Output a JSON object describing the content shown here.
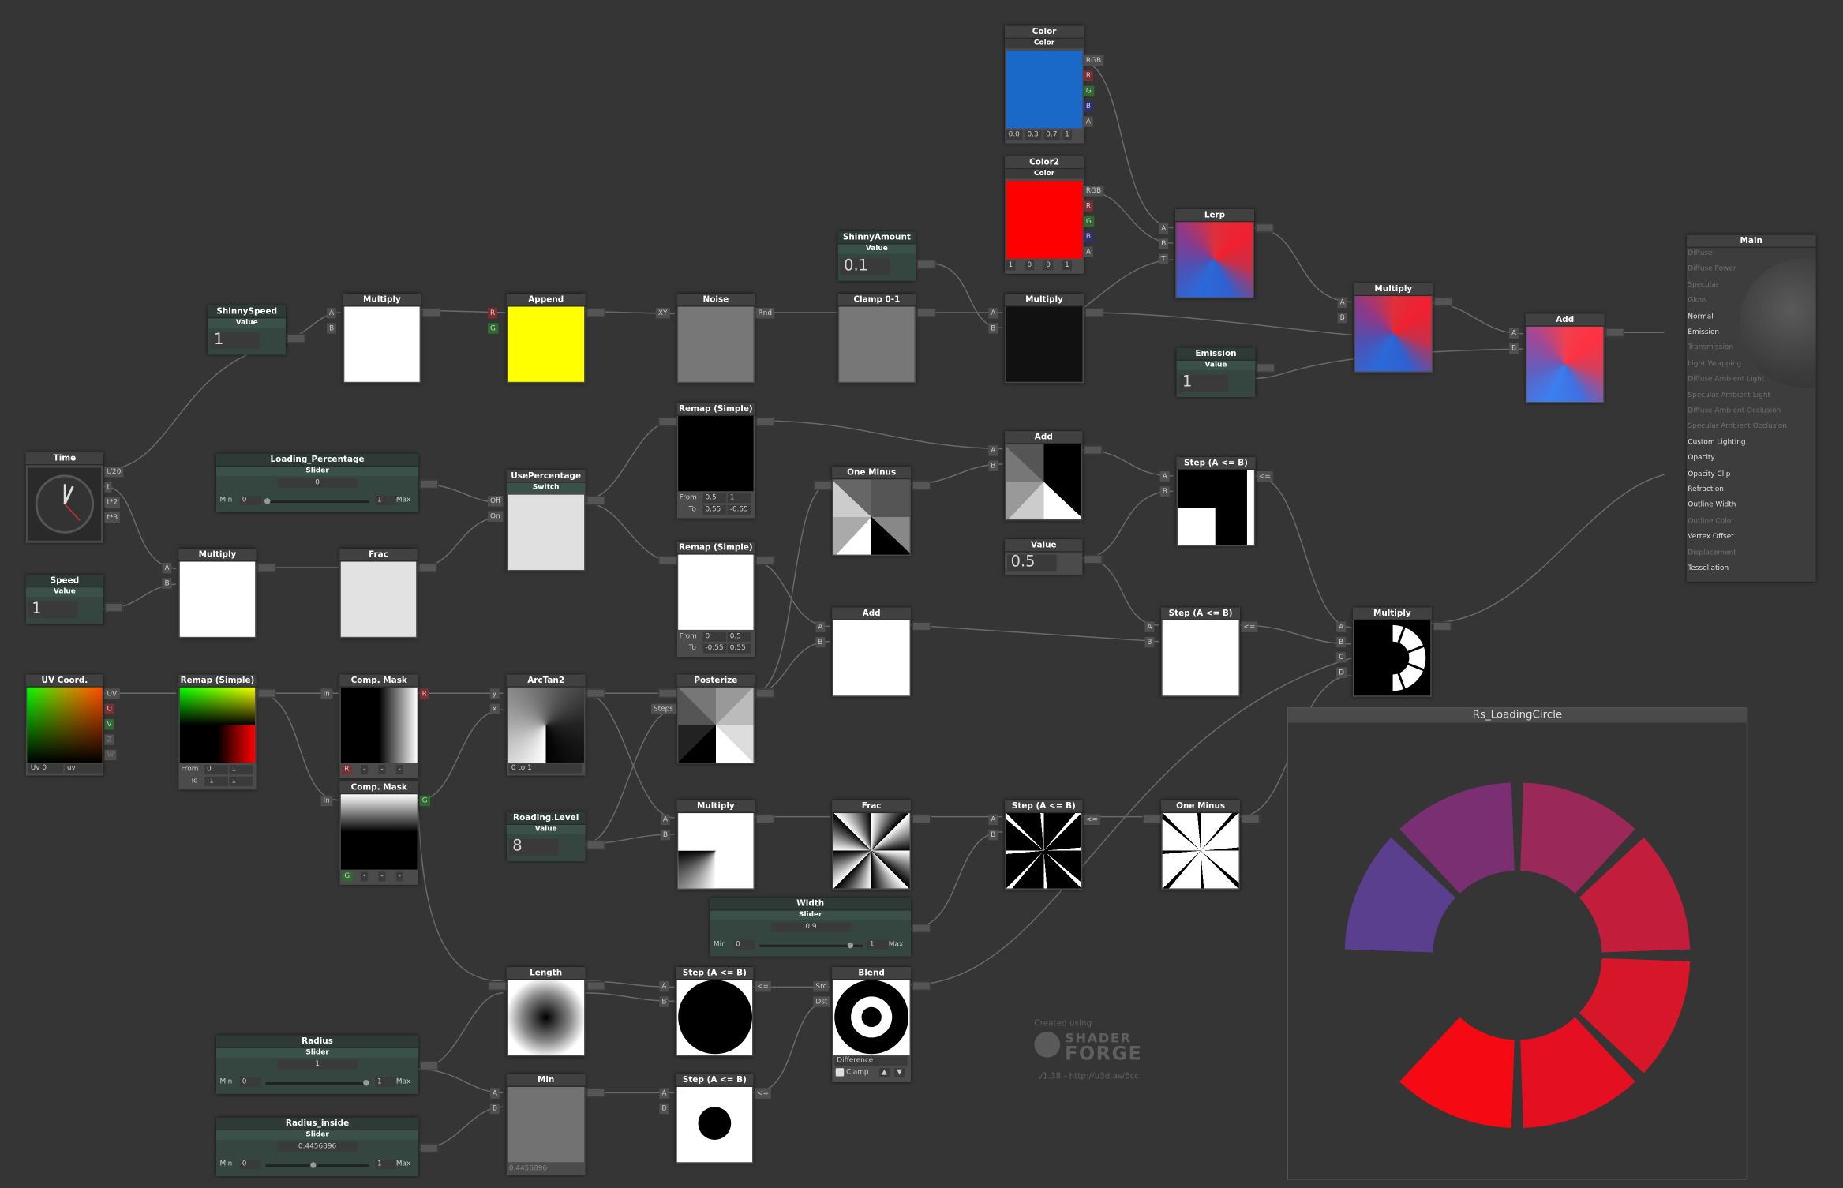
{
  "app": {
    "title": "Shader Forge"
  },
  "colors": {
    "canvas": "#353535",
    "node": "#4b4b4b",
    "property_node": "#35453f",
    "wire": "#6a6a6a",
    "accent_blue": "#1a68c8",
    "accent_red": "#ff0000",
    "yellow": "#ffff00"
  },
  "nodes": {
    "time": {
      "title": "Time",
      "ports": [
        "t/20",
        "t",
        "t*2",
        "t*3"
      ]
    },
    "speed": {
      "title": "Speed",
      "sub": "Value",
      "value": "1"
    },
    "shinny_speed": {
      "title": "ShinnySpeed",
      "sub": "Value",
      "value": "1"
    },
    "multiply_a": {
      "title": "Multiply"
    },
    "append": {
      "title": "Append",
      "ports_in": [
        "R",
        "G"
      ]
    },
    "noise": {
      "title": "Noise",
      "port_in": "XY",
      "port_out": "Rnd"
    },
    "clamp01": {
      "title": "Clamp 0-1"
    },
    "shinny_amount": {
      "title": "ShinnyAmount",
      "sub": "Value",
      "value": "0.1"
    },
    "multiply_b": {
      "title": "Multiply"
    },
    "color1": {
      "title": "Color",
      "sub": "Color",
      "values": [
        "0.0",
        "0.3",
        "0.7",
        "1"
      ],
      "ports": [
        "RGB",
        "R",
        "G",
        "B",
        "A"
      ]
    },
    "color2": {
      "title": "Color2",
      "sub": "Color",
      "values": [
        "1",
        "0",
        "0",
        "1"
      ],
      "ports": [
        "RGB",
        "R",
        "G",
        "B",
        "A"
      ]
    },
    "lerp": {
      "title": "Lerp",
      "ports": [
        "A",
        "B",
        "T"
      ]
    },
    "multiply_c": {
      "title": "Multiply"
    },
    "add_main": {
      "title": "Add"
    },
    "emission": {
      "title": "Emission",
      "sub": "Value",
      "value": "1"
    },
    "loading_percentage": {
      "title": "Loading_Percentage",
      "sub": "Slider",
      "value": "0",
      "min_label": "Min",
      "min": "0",
      "max": "1",
      "max_label": "Max",
      "fill": 0.0
    },
    "use_percentage": {
      "title": "UsePercentage",
      "sub": "Switch",
      "ports": [
        "Off",
        "On"
      ]
    },
    "remap_top": {
      "title": "Remap (Simple)",
      "from_label": "From",
      "to_label": "To",
      "from": [
        "0.5",
        "1"
      ],
      "to": [
        "0.55",
        "-0.55"
      ]
    },
    "remap_mid": {
      "title": "Remap (Simple)",
      "from_label": "From",
      "to_label": "To",
      "from": [
        "0",
        "0.5"
      ],
      "to": [
        "-0.55",
        "0.55"
      ]
    },
    "multiply_d": {
      "title": "Multiply"
    },
    "frac_a": {
      "title": "Frac"
    },
    "one_minus_a": {
      "title": "One Minus"
    },
    "add_mid": {
      "title": "Add"
    },
    "value_half": {
      "title": "Value",
      "value": "0.5"
    },
    "step_a": {
      "title": "Step (A <= B)",
      "out": "<="
    },
    "add_lower": {
      "title": "Add"
    },
    "step_b": {
      "title": "Step (A <= B)",
      "out": "<="
    },
    "multiply_out": {
      "title": "Multiply",
      "ports": [
        "A",
        "B",
        "C",
        "D"
      ]
    },
    "uv_coord": {
      "title": "UV Coord.",
      "ports": [
        "UV",
        "U",
        "V",
        "Z",
        "W"
      ],
      "channel": "Uv 0",
      "mode": "uv"
    },
    "remap_uv": {
      "title": "Remap (Simple)",
      "from_label": "From",
      "to_label": "To",
      "from": [
        "0",
        "1"
      ],
      "to": [
        "-1",
        "1"
      ]
    },
    "comp_mask_r": {
      "title": "Comp. Mask",
      "port_in": "In",
      "port_out": "R",
      "channel": "R"
    },
    "comp_mask_g": {
      "title": "Comp. Mask",
      "port_in": "In",
      "port_out": "G",
      "channel": "G"
    },
    "arctan2": {
      "title": "ArcTan2",
      "ports": [
        "y",
        "x"
      ],
      "mode": "0 to 1"
    },
    "posterize": {
      "title": "Posterize",
      "port": "Steps"
    },
    "roading_level": {
      "title": "Roading.Level",
      "sub": "Value",
      "value": "8"
    },
    "multiply_e": {
      "title": "Multiply"
    },
    "frac_b": {
      "title": "Frac"
    },
    "step_c": {
      "title": "Step (A <= B)",
      "out": "<="
    },
    "one_minus_b": {
      "title": "One Minus"
    },
    "width": {
      "title": "Width",
      "sub": "Slider",
      "value": "0.9",
      "min_label": "Min",
      "min": "0",
      "max": "1",
      "max_label": "Max",
      "fill": 0.9
    },
    "length": {
      "title": "Length"
    },
    "step_d": {
      "title": "Step (A <= B)",
      "out": "<="
    },
    "blend": {
      "title": "Blend",
      "ports": [
        "Src",
        "Dst"
      ],
      "mode": "Difference",
      "clamp": "Clamp"
    },
    "step_e": {
      "title": "Step (A <= B)",
      "out": "<="
    },
    "min": {
      "title": "Min",
      "value": "0.4456896"
    },
    "radius": {
      "title": "Radius",
      "sub": "Slider",
      "value": "1",
      "min_label": "Min",
      "min": "0",
      "max": "1",
      "max_label": "Max",
      "fill": 1.0
    },
    "radius_inside": {
      "title": "Radius_inside",
      "sub": "Slider",
      "value": "0.4456896",
      "min_label": "Min",
      "min": "0",
      "max": "1",
      "max_label": "Max",
      "fill": 0.4456896
    }
  },
  "main": {
    "title": "Main",
    "inputs": [
      {
        "label": "Diffuse",
        "enabled": false
      },
      {
        "label": "Diffuse Power",
        "enabled": false
      },
      {
        "label": "Specular",
        "enabled": false
      },
      {
        "label": "Gloss",
        "enabled": false
      },
      {
        "label": "Normal",
        "enabled": true
      },
      {
        "label": "Emission",
        "enabled": true
      },
      {
        "label": "Transmission",
        "enabled": false
      },
      {
        "label": "Light Wrapping",
        "enabled": false
      },
      {
        "label": "Diffuse Ambient Light",
        "enabled": false
      },
      {
        "label": "Specular Ambient Light",
        "enabled": false
      },
      {
        "label": "Diffuse Ambient Occlusion",
        "enabled": false
      },
      {
        "label": "Specular Ambient Occlusion",
        "enabled": false
      },
      {
        "label": "Custom Lighting",
        "enabled": true
      },
      {
        "label": "Opacity",
        "enabled": true
      },
      {
        "label": "Opacity Clip",
        "enabled": true
      },
      {
        "label": "Refraction",
        "enabled": true
      },
      {
        "label": "Outline Width",
        "enabled": true
      },
      {
        "label": "Outline Color",
        "enabled": false
      },
      {
        "label": "Vertex Offset",
        "enabled": true
      },
      {
        "label": "Displacement",
        "enabled": false
      },
      {
        "label": "Tessellation",
        "enabled": true
      }
    ]
  },
  "preview": {
    "title": "Rs_LoadingCircle"
  },
  "watermark": {
    "created": "Created using",
    "logo_line1": "SHADER",
    "logo_line2": "FORGE",
    "version": "v1.38 - http://u3d.as/6cc"
  }
}
